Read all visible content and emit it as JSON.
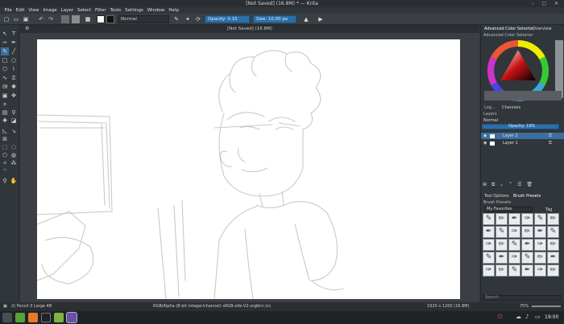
{
  "window": {
    "title": "[Not Saved]  (16.8M)  * — Krita",
    "controls": "– ▢ ✕"
  },
  "menu": [
    "File",
    "Edit",
    "View",
    "Image",
    "Layer",
    "Select",
    "Filter",
    "Tools",
    "Settings",
    "Window",
    "Help"
  ],
  "toolbar": {
    "blend_mode": "Normal",
    "opacity_label": "Opacity: 0.15",
    "size_label": "Size: 10.00 px"
  },
  "canvas": {
    "tab_title": "[Not Saved]  (16.8M)"
  },
  "dock": {
    "tab_color_selector": "Advanced Color Selector",
    "tab_overview": "Overview",
    "color_selector_title": "Advanced Color Selector",
    "tab_log": "Log...",
    "tab_channels": "Channels",
    "layers_title": "Layers",
    "layers_blend": "Normal",
    "layers_opacity": "Opacity:  19%",
    "layers": [
      {
        "name": "Layer 2",
        "selected": true
      },
      {
        "name": "Layer 1",
        "selected": false
      }
    ],
    "tab_tool_options": "Tool Options",
    "tab_brush_presets": "Brush Presets",
    "brush_presets_title": "Brush Presets",
    "favorites": "My Favorites",
    "tag_label": "Tag",
    "search_placeholder": "Search"
  },
  "status": {
    "brush": "2) Pencil-3 Large 4B",
    "color_info": "RGB/Alpha (8-bit integer/channel)   sRGB-elle-V2-srgbtrc.icc",
    "dimensions": "1920 x 1200 (16.8M)",
    "zoom": "75%"
  },
  "taskbar": {
    "clock": "19:00"
  },
  "colors": {
    "accent": "#3b6fa1",
    "panel": "#31363b",
    "canvas_bg": "#ffffff"
  }
}
